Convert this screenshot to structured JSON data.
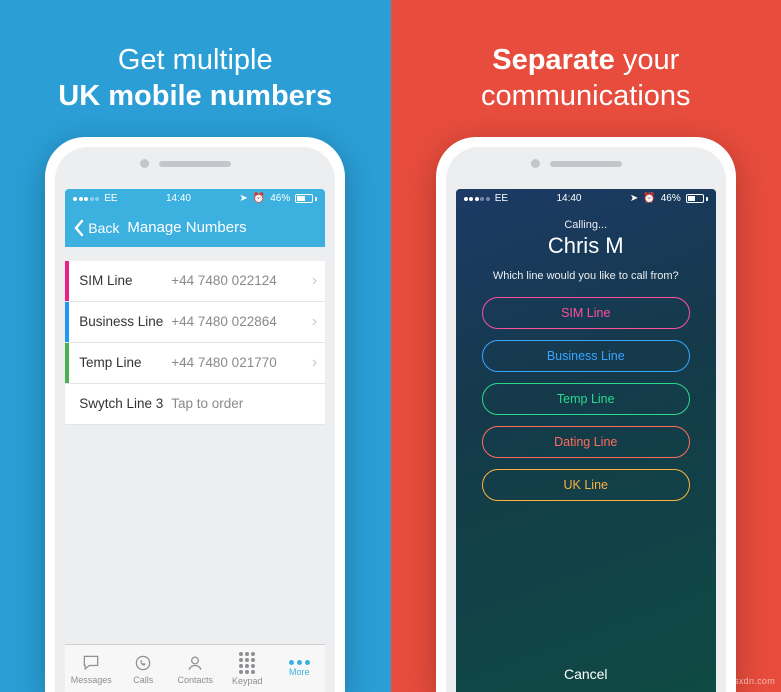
{
  "left": {
    "headline_1": "Get multiple",
    "headline_2": "UK mobile numbers",
    "status": {
      "carrier": "EE",
      "time": "14:40",
      "battery": "46%"
    },
    "nav": {
      "back": "Back",
      "title": "Manage Numbers"
    },
    "rows": [
      {
        "label": "SIM Line",
        "value": "+44 7480 022124",
        "tag": "pink",
        "chev": true
      },
      {
        "label": "Business Line",
        "value": "+44 7480 022864",
        "tag": "blue",
        "chev": true
      },
      {
        "label": "Temp Line",
        "value": "+44 7480 021770",
        "tag": "green",
        "chev": true
      },
      {
        "label": "Swytch Line 3",
        "value": "Tap to order",
        "tag": "none",
        "chev": false
      }
    ],
    "tabs": {
      "messages": "Messages",
      "calls": "Calls",
      "contacts": "Contacts",
      "keypad": "Keypad",
      "more": "More"
    }
  },
  "right": {
    "headline_1": "Separate",
    "headline_2": "your",
    "headline_3": "communications",
    "status": {
      "carrier": "EE",
      "time": "14:40",
      "battery": "46%"
    },
    "calling": "Calling...",
    "name": "Chris M",
    "question": "Which line would you like to call from?",
    "lines": [
      {
        "label": "SIM Line",
        "cls": "pink"
      },
      {
        "label": "Business Line",
        "cls": "blue"
      },
      {
        "label": "Temp Line",
        "cls": "green"
      },
      {
        "label": "Dating Line",
        "cls": "red"
      },
      {
        "label": "UK Line",
        "cls": "orange"
      }
    ],
    "cancel": "Cancel"
  },
  "watermark": "wsxdn.com"
}
